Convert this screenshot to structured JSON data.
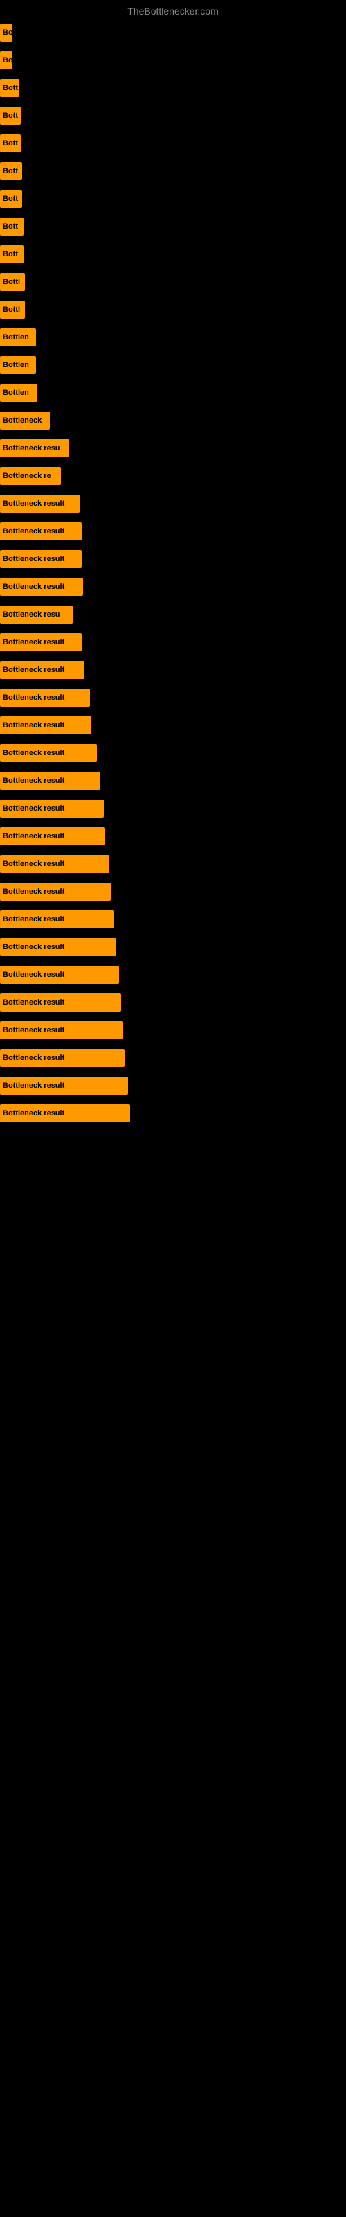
{
  "site_title": "TheBottlenecker.com",
  "bars": [
    {
      "label": "Bo",
      "width": 18
    },
    {
      "label": "Bo",
      "width": 18
    },
    {
      "label": "Bott",
      "width": 28
    },
    {
      "label": "Bott",
      "width": 30
    },
    {
      "label": "Bott",
      "width": 30
    },
    {
      "label": "Bott",
      "width": 32
    },
    {
      "label": "Bott",
      "width": 32
    },
    {
      "label": "Bott",
      "width": 34
    },
    {
      "label": "Bott",
      "width": 34
    },
    {
      "label": "Bottl",
      "width": 36
    },
    {
      "label": "Bottl",
      "width": 36
    },
    {
      "label": "Bottlen",
      "width": 52
    },
    {
      "label": "Bottlen",
      "width": 52
    },
    {
      "label": "Bottlen",
      "width": 54
    },
    {
      "label": "Bottleneck",
      "width": 72
    },
    {
      "label": "Bottleneck resu",
      "width": 100
    },
    {
      "label": "Bottleneck re",
      "width": 88
    },
    {
      "label": "Bottleneck result",
      "width": 115
    },
    {
      "label": "Bottleneck result",
      "width": 118
    },
    {
      "label": "Bottleneck result",
      "width": 118
    },
    {
      "label": "Bottleneck result",
      "width": 120
    },
    {
      "label": "Bottleneck resu",
      "width": 105
    },
    {
      "label": "Bottleneck result",
      "width": 118
    },
    {
      "label": "Bottleneck result",
      "width": 122
    },
    {
      "label": "Bottleneck result",
      "width": 130
    },
    {
      "label": "Bottleneck result",
      "width": 132
    },
    {
      "label": "Bottleneck result",
      "width": 140
    },
    {
      "label": "Bottleneck result",
      "width": 145
    },
    {
      "label": "Bottleneck result",
      "width": 150
    },
    {
      "label": "Bottleneck result",
      "width": 152
    },
    {
      "label": "Bottleneck result",
      "width": 158
    },
    {
      "label": "Bottleneck result",
      "width": 160
    },
    {
      "label": "Bottleneck result",
      "width": 165
    },
    {
      "label": "Bottleneck result",
      "width": 168
    },
    {
      "label": "Bottleneck result",
      "width": 172
    },
    {
      "label": "Bottleneck result",
      "width": 175
    },
    {
      "label": "Bottleneck result",
      "width": 178
    },
    {
      "label": "Bottleneck result",
      "width": 180
    },
    {
      "label": "Bottleneck result",
      "width": 185
    },
    {
      "label": "Bottleneck result",
      "width": 188
    }
  ]
}
